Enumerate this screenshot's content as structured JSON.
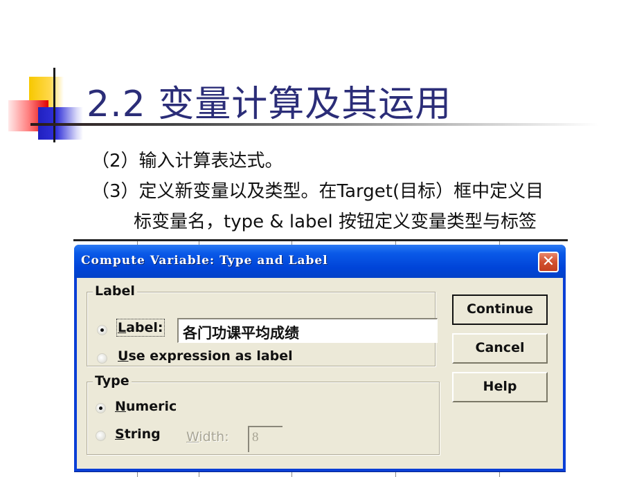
{
  "slide": {
    "title": "2.2 变量计算及其运用",
    "lines": [
      "（2）输入计算表达式。",
      "（3）定义新变量以及类型。在Target(目标）框中定义目",
      "标变量名，type & label 按钮定义变量类型与标签"
    ]
  },
  "dialog": {
    "title": "Compute Variable: Type and Label",
    "close_icon": "✕",
    "label_group": {
      "legend": "Label",
      "options": [
        {
          "mnemonic": "L",
          "rest": "abel:",
          "checked": true
        },
        {
          "mnemonic": "U",
          "rest": "se expression as label",
          "checked": false
        }
      ],
      "label_value": "各门功课平均成绩"
    },
    "type_group": {
      "legend": "Type",
      "options": [
        {
          "mnemonic": "N",
          "rest": "umeric",
          "checked": true
        },
        {
          "mnemonic": "S",
          "rest": "tring",
          "checked": false
        }
      ],
      "width_mnemonic": "W",
      "width_rest": "idth:",
      "width_value": "8"
    },
    "buttons": {
      "continue": "Continue",
      "cancel": "Cancel",
      "help": "Help"
    }
  }
}
